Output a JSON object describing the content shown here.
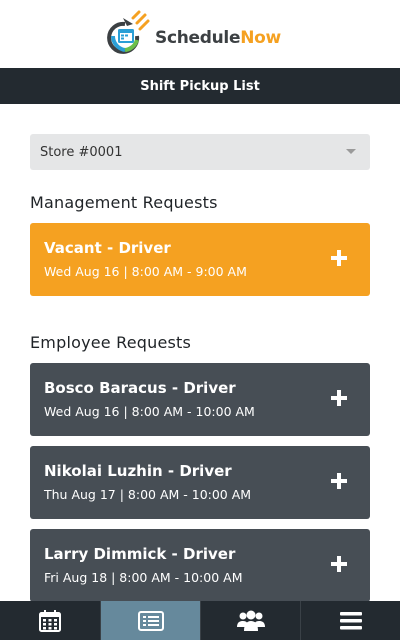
{
  "app": {
    "logo_schedule": "Schedule",
    "logo_now": "Now"
  },
  "header": {
    "title": "Shift Pickup List"
  },
  "store_select": {
    "selected": "Store #0001"
  },
  "management": {
    "heading": "Management Requests",
    "requests": [
      {
        "title": "Vacant - Driver",
        "time": "Wed Aug 16 | 8:00 AM - 9:00 AM"
      }
    ]
  },
  "employee": {
    "heading": "Employee Requests",
    "requests": [
      {
        "title": "Bosco Baracus - Driver",
        "time": "Wed Aug 16 | 8:00 AM - 10:00 AM"
      },
      {
        "title": "Nikolai Luzhin - Driver",
        "time": "Thu Aug 17 | 8:00 AM - 10:00 AM"
      },
      {
        "title": "Larry Dimmick - Driver",
        "time": "Fri Aug 18 | 8:00 AM - 10:00 AM"
      }
    ]
  },
  "tabs": [
    {
      "icon": "calendar-icon",
      "active": false
    },
    {
      "icon": "list-icon",
      "active": true
    },
    {
      "icon": "people-icon",
      "active": false
    },
    {
      "icon": "menu-icon",
      "active": false
    }
  ],
  "colors": {
    "brand_orange": "#f5a121",
    "dark_bar": "#232a30",
    "card_gray": "#474e55",
    "active_tab": "#66899c"
  }
}
